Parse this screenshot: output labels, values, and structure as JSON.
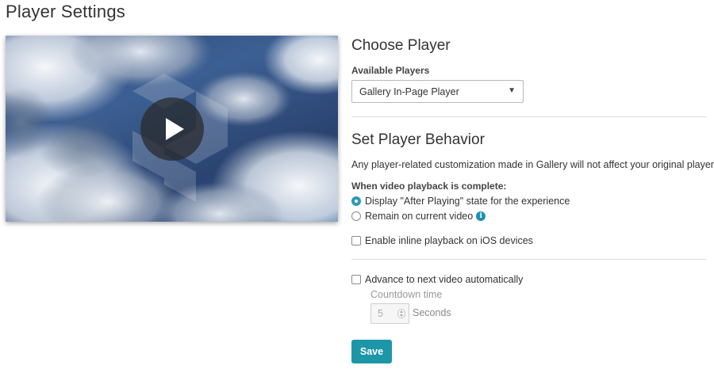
{
  "page": {
    "title": "Player Settings"
  },
  "video_preview": {
    "thumbnail": "sky-clouds-thumbnail",
    "play_icon": "play-icon"
  },
  "choose_player": {
    "heading": "Choose Player",
    "field_label": "Available Players",
    "selected_value": "Gallery In-Page Player",
    "arrow_glyph": "▼"
  },
  "player_behavior": {
    "heading": "Set Player Behavior",
    "description": "Any player-related customization made in Gallery will not affect your original player.",
    "completion_label": "When video playback is complete:",
    "options": [
      {
        "label": "Display \"After Playing\" state for the experience",
        "checked": true
      },
      {
        "label": "Remain on current video",
        "checked": false,
        "info_icon": "i"
      }
    ],
    "inline_ios": {
      "label": "Enable inline playback on iOS devices",
      "checked": false
    },
    "advance": {
      "label": "Advance to next video automatically",
      "checked": false
    },
    "countdown": {
      "label": "Countdown time",
      "value": "5",
      "unit": "Seconds"
    }
  },
  "actions": {
    "save_label": "Save"
  },
  "colors": {
    "accent": "#1d96a8",
    "info": "#1f8fb4"
  }
}
